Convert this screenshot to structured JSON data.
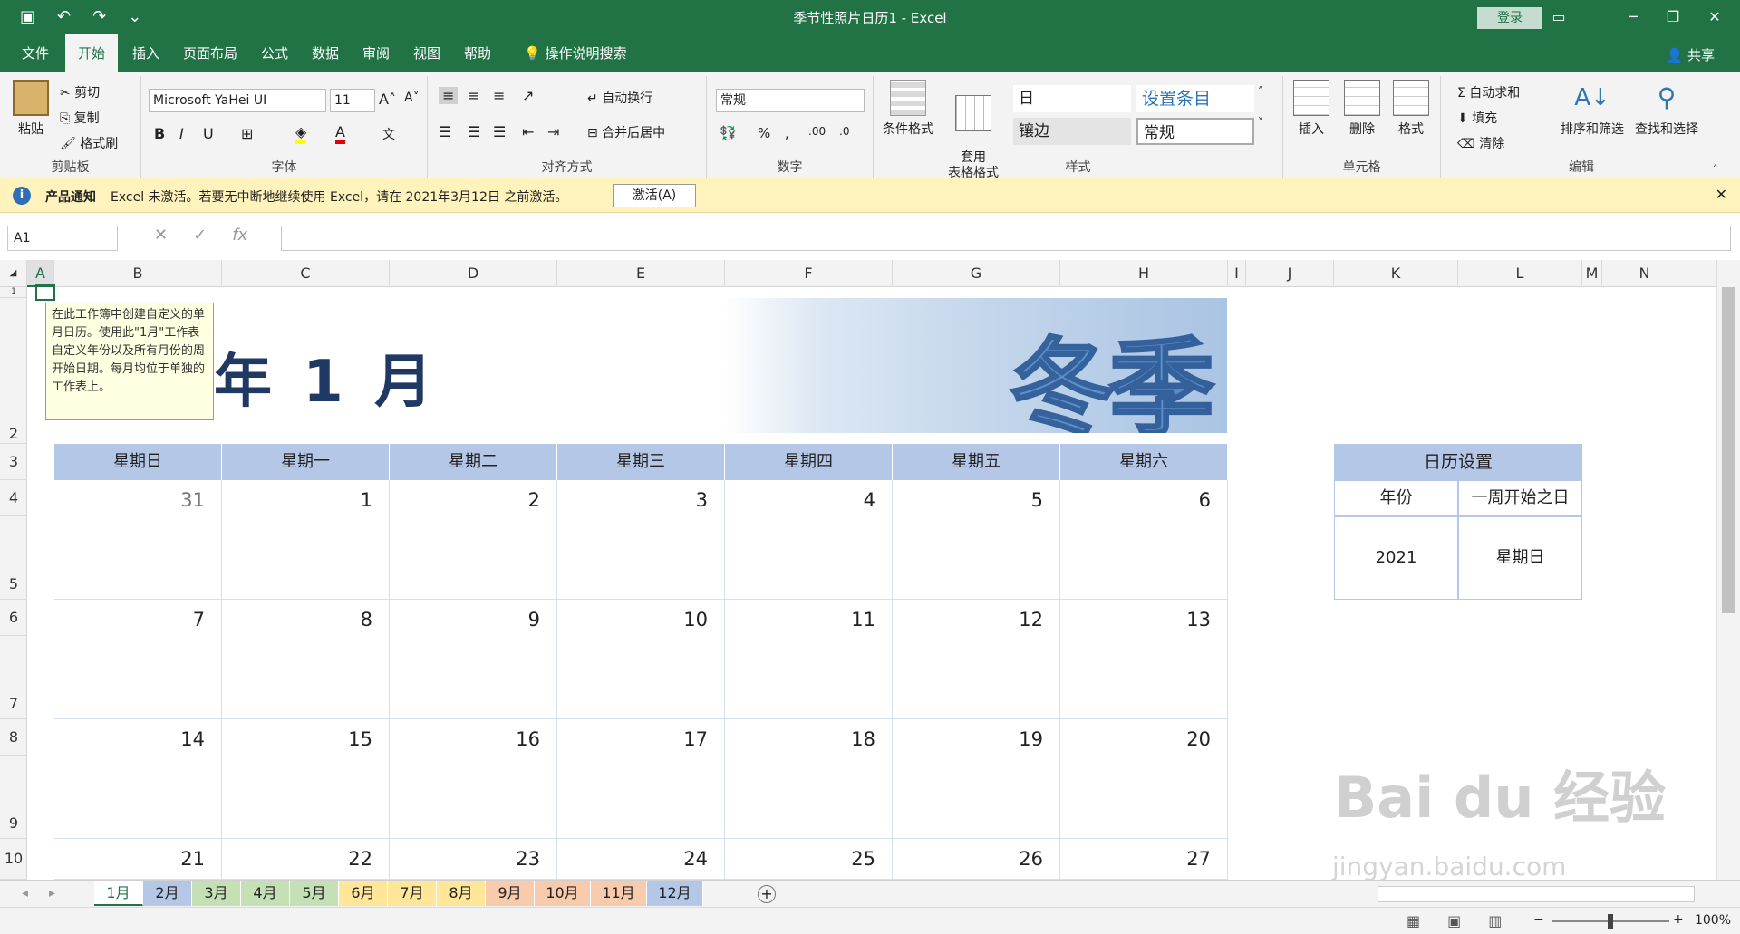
{
  "window": {
    "title": "季节性照片日历1  -  Excel",
    "login": "登录"
  },
  "tabs": [
    "文件",
    "开始",
    "插入",
    "页面布局",
    "公式",
    "数据",
    "审阅",
    "视图",
    "帮助",
    "操作说明搜索"
  ],
  "active_tab": "开始",
  "share": "共享",
  "ribbon": {
    "clipboard": {
      "paste": "粘贴",
      "cut": "剪切",
      "copy": "复制",
      "format_painter": "格式刷",
      "label": "剪贴板"
    },
    "font": {
      "name": "Microsoft YaHei UI",
      "size": "11",
      "label": "字体"
    },
    "alignment": {
      "wrap": "自动换行",
      "merge": "合并后居中",
      "label": "对齐方式"
    },
    "number": {
      "format": "常规",
      "label": "数字"
    },
    "styles": {
      "cond": "条件格式",
      "table": "套用\n表格格式",
      "cell1": "日",
      "cell2": "设置条目",
      "cell3": "镶边",
      "cell4": "常规",
      "label": "样式"
    },
    "cells": {
      "insert": "插入",
      "delete": "删除",
      "format": "格式",
      "label": "单元格"
    },
    "editing": {
      "autosum": "自动求和",
      "fill": "填充",
      "clear": "清除",
      "sort": "排序和筛选",
      "find": "查找和选择",
      "label": "编辑"
    }
  },
  "notice": {
    "title": "产品通知",
    "text": "Excel 未激活。若要无中断地继续使用 Excel，请在 2021年3月12日 之前激活。",
    "button": "激活(A)"
  },
  "namebox": "A1",
  "columns": [
    "A",
    "B",
    "C",
    "D",
    "E",
    "F",
    "G",
    "H",
    "I",
    "J",
    "K",
    "L",
    "M",
    "N"
  ],
  "rows": [
    "1",
    "2",
    "3",
    "4",
    "5",
    "6",
    "7",
    "8",
    "9",
    "10"
  ],
  "tooltip": "在此工作簿中创建自定义的单月日历。使用此\"1月\"工作表自定义年份以及所有月份的周开始日期。每月均位于单独的工作表上。",
  "month_title": "年 1 月",
  "banner_text": "冬季",
  "weekdays": [
    "星期日",
    "星期一",
    "星期二",
    "星期三",
    "星期四",
    "星期五",
    "星期六"
  ],
  "weeks": [
    [
      "31",
      "1",
      "2",
      "3",
      "4",
      "5",
      "6"
    ],
    [
      "7",
      "8",
      "9",
      "10",
      "11",
      "12",
      "13"
    ],
    [
      "14",
      "15",
      "16",
      "17",
      "18",
      "19",
      "20"
    ],
    [
      "21",
      "22",
      "23",
      "24",
      "25",
      "26",
      "27"
    ]
  ],
  "settings": {
    "title": "日历设置",
    "year_label": "年份",
    "start_label": "一周开始之日",
    "year": "2021",
    "start": "星期日"
  },
  "sheet_tabs": [
    {
      "name": "1月",
      "color": "#ffffff"
    },
    {
      "name": "2月",
      "color": "#b4c7e7"
    },
    {
      "name": "3月",
      "color": "#c5e0b4"
    },
    {
      "name": "4月",
      "color": "#c5e0b4"
    },
    {
      "name": "5月",
      "color": "#c5e0b4"
    },
    {
      "name": "6月",
      "color": "#ffe699"
    },
    {
      "name": "7月",
      "color": "#ffe699"
    },
    {
      "name": "8月",
      "color": "#ffe699"
    },
    {
      "name": "9月",
      "color": "#f8cbad"
    },
    {
      "name": "10月",
      "color": "#f8cbad"
    },
    {
      "name": "11月",
      "color": "#f8cbad"
    },
    {
      "name": "12月",
      "color": "#b4c7e7"
    }
  ],
  "zoom": "100%",
  "watermark": "Bai du 经验",
  "watermark_url": "jingyan.baidu.com"
}
